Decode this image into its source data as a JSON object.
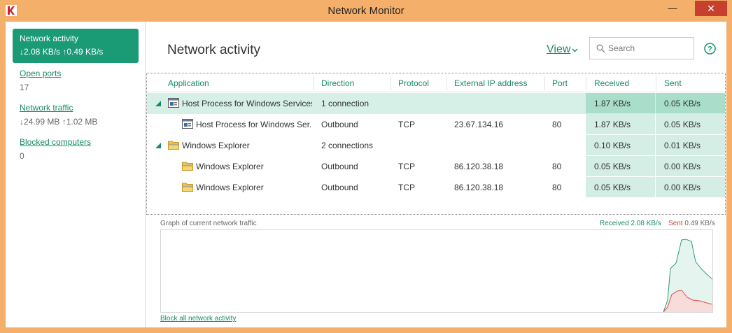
{
  "window": {
    "title": "Network Monitor",
    "minimize_glyph": "—",
    "maximize_glyph": "☐",
    "close_glyph": "✕"
  },
  "sidebar": {
    "active": {
      "label": "Network activity",
      "value": "↓2.08 KB/s   ↑0.49 KB/s"
    },
    "items": [
      {
        "label": "Open ports",
        "value": "17"
      },
      {
        "label": "Network traffic",
        "value": "↓24.99 MB    ↑1.02 MB"
      },
      {
        "label": "Blocked computers",
        "value": "0"
      }
    ]
  },
  "header": {
    "title": "Network activity",
    "view_label": "View",
    "search_placeholder": "Search"
  },
  "table": {
    "columns": [
      "Application",
      "Direction",
      "Protocol",
      "External IP address",
      "Port",
      "Received",
      "Sent"
    ],
    "rows": [
      {
        "level": 0,
        "icon": "service-icon",
        "app": "Host Process for Windows Services",
        "direction": "1 connection",
        "protocol": "",
        "ip": "",
        "port": "",
        "received": "1.87 KB/s",
        "sent": "0.05 KB/s",
        "selected": true
      },
      {
        "level": 1,
        "icon": "service-icon",
        "app": "Host Process for Windows Ser...",
        "direction": "Outbound",
        "protocol": "TCP",
        "ip": "23.67.134.16",
        "port": "80",
        "received": "1.87 KB/s",
        "sent": "0.05 KB/s"
      },
      {
        "level": 0,
        "icon": "folder-icon",
        "app": "Windows Explorer",
        "direction": "2 connections",
        "protocol": "",
        "ip": "",
        "port": "",
        "received": "0.10 KB/s",
        "sent": "0.01 KB/s"
      },
      {
        "level": 1,
        "icon": "folder-icon",
        "app": "Windows Explorer",
        "direction": "Outbound",
        "protocol": "TCP",
        "ip": "86.120.38.18",
        "port": "80",
        "received": "0.05 KB/s",
        "sent": "0.00 KB/s"
      },
      {
        "level": 1,
        "icon": "folder-icon",
        "app": "Windows Explorer",
        "direction": "Outbound",
        "protocol": "TCP",
        "ip": "86.120.38.18",
        "port": "80",
        "received": "0.05 KB/s",
        "sent": "0.00 KB/s"
      }
    ]
  },
  "graph": {
    "title": "Graph of current network traffic",
    "received_label": "Received 2.08 KB/s",
    "sent_label": "Sent",
    "sent_value": "0.49 KB/s",
    "colors": {
      "received": "#2e9e77",
      "sent": "#d9534f"
    }
  },
  "footer": {
    "block_link": "Block all network activity"
  },
  "colors": {
    "accent": "#1b9a76",
    "frame": "#f4b06a",
    "close": "#c7402d"
  }
}
